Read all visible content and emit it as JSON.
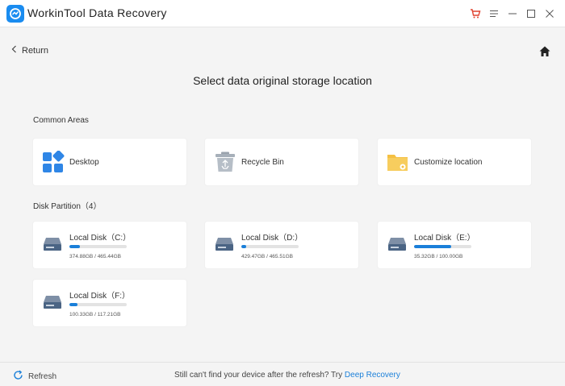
{
  "app": {
    "title": "WorkinTool Data Recovery"
  },
  "nav": {
    "return_label": "Return"
  },
  "page": {
    "title": "Select data original storage location"
  },
  "common_areas": {
    "label": "Common Areas",
    "items": [
      {
        "label": "Desktop",
        "icon": "desktop-tiles-icon"
      },
      {
        "label": "Recycle Bin",
        "icon": "recycle-bin-icon"
      },
      {
        "label": "Customize location",
        "icon": "folder-gear-icon"
      }
    ]
  },
  "disk_partition": {
    "label": "Disk Partition（4）",
    "disks": [
      {
        "name": "Local Disk（C:）",
        "size": "374.88GB / 465.44GB",
        "used_fraction": 0.19
      },
      {
        "name": "Local Disk（D:）",
        "size": "429.47GB / 465.51GB",
        "used_fraction": 0.08
      },
      {
        "name": "Local Disk（E:）",
        "size": "35.32GB / 100.00GB",
        "used_fraction": 0.65
      },
      {
        "name": "Local Disk（F:）",
        "size": "100.33GB / 117.21GB",
        "used_fraction": 0.14
      }
    ]
  },
  "footer": {
    "refresh_label": "Refresh",
    "hint_text": "Still can't find your device after the refresh? Try",
    "hint_link": "Deep Recovery"
  },
  "colors": {
    "accent": "#1a7fd9",
    "cart": "#e0422f",
    "folder": "#f5c042"
  }
}
